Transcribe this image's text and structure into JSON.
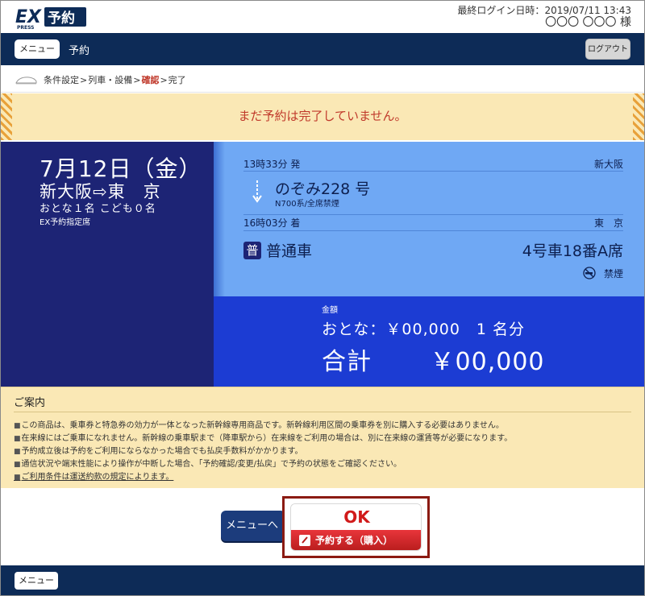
{
  "header": {
    "logo_text": "EX予約",
    "logo_sub": "PRESS",
    "last_login_label": "最終ログイン日時：",
    "last_login": "2019/07/11 13:43",
    "user_name": "〇〇〇 〇〇〇 様"
  },
  "nav": {
    "menu_label": "メニュー",
    "title": "予約",
    "logout_label": "ログアウト"
  },
  "breadcrumb": {
    "steps": [
      "条件設定",
      "列車・設備",
      "確認",
      "完了"
    ],
    "separator": ">"
  },
  "warning": "まだ予約は完了していません。",
  "reservation": {
    "date": "7月12日（金）",
    "route": "新大阪⇨東　京",
    "passengers": "おとな１名 こども０名",
    "ticket_type": "EX予約指定席",
    "departure_time": "13時33分 発",
    "departure_station": "新大阪",
    "train_name": "のぞみ228 号",
    "train_type": "N700系/全席禁煙",
    "arrival_time": "16時03分 着",
    "arrival_station": "東　京",
    "class_icon": "普",
    "class_label": "普通車",
    "seat": "4号車18番A席",
    "smoking": "禁煙"
  },
  "price": {
    "label": "金額",
    "adult_line": "おとな：￥00,000　1 名分",
    "total_line": "合計　　 ￥00,000"
  },
  "guide": {
    "title": "ご案内",
    "items": [
      "この商品は、乗車券と特急券の効力が一体となった新幹線専用商品です。新幹線利用区間の乗車券を別に購入する必要はありません。",
      "在来線にはご乗車になれません。新幹線の乗車駅まで（降車駅から）在来線をご利用の場合は、別に在来線の運賃等が必要になります。",
      "予約成立後は予約をご利用にならなかった場合でも払戻手数料がかかります。",
      "通信状況や端末性能により操作が中断した場合、「予約確認/変更/払戻」で予約の状態をご確認ください。",
      "ご利用条件は運送約款の規定によります。"
    ]
  },
  "actions": {
    "back_label": "メニューへ",
    "ok_label": "OK",
    "reserve_label": "予約する（購入）"
  },
  "footer": {
    "menu_label": "メニュー"
  },
  "colors": {
    "navy": "#0d2b57",
    "summary_left": "#1d2475",
    "train_panel": "#6fa8f4",
    "price_panel": "#1c3cd3",
    "notice_bg": "#fae8b5",
    "warning_text": "#c0392b"
  }
}
